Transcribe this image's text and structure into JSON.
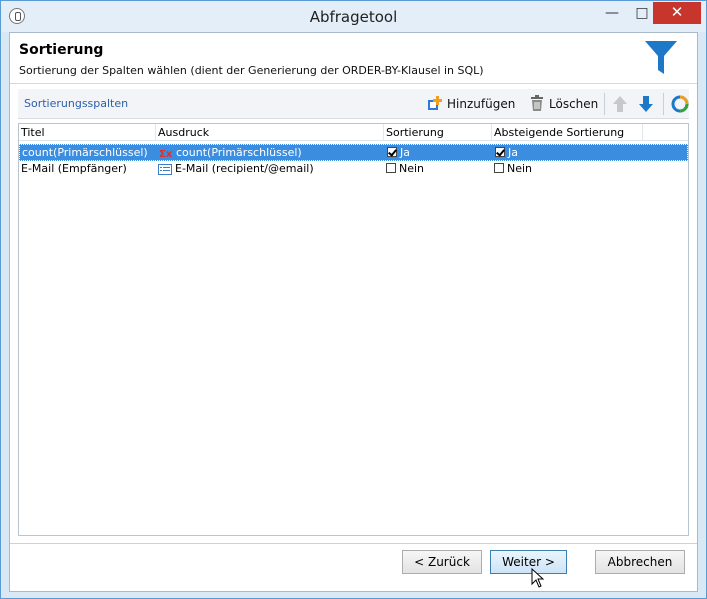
{
  "window": {
    "title": "Abfragetool",
    "minimize": "—",
    "maximize": "□",
    "close": "✕"
  },
  "header": {
    "title": "Sortierung",
    "subtitle": "Sortierung der Spalten wählen (dient der Generierung der ORDER-BY-Klausel in SQL)",
    "icon": "funnel-icon"
  },
  "toolbar": {
    "label": "Sortierungsspalten",
    "add_label": "Hinzufügen",
    "delete_label": "Löschen",
    "icons": [
      "add-icon",
      "trash-icon",
      "arrow-up-icon",
      "arrow-down-icon",
      "configure-icon"
    ]
  },
  "grid": {
    "columns": [
      "Titel",
      "Ausdruck",
      "Sortierung",
      "Absteigende Sortierung"
    ],
    "rows": [
      {
        "title": "count(Primärschlüssel)",
        "expression": "count(Primärschlüssel)",
        "expression_icon": "aggregate-icon",
        "sort": "Ja",
        "sort_checked": true,
        "desc": "Ja",
        "desc_checked": true,
        "selected": true
      },
      {
        "title": "E-Mail (Empfänger)",
        "expression": "E-Mail (recipient/@email)",
        "expression_icon": "field-icon",
        "sort": "Nein",
        "sort_checked": false,
        "desc": "Nein",
        "desc_checked": false,
        "selected": false
      }
    ]
  },
  "footer": {
    "back_label": "< Zurück",
    "next_label": "Weiter >",
    "cancel_label": "Abbrechen"
  },
  "colors": {
    "selection": "#3b8de0",
    "accent": "#1e78c8",
    "close_button": "#c7352c"
  }
}
